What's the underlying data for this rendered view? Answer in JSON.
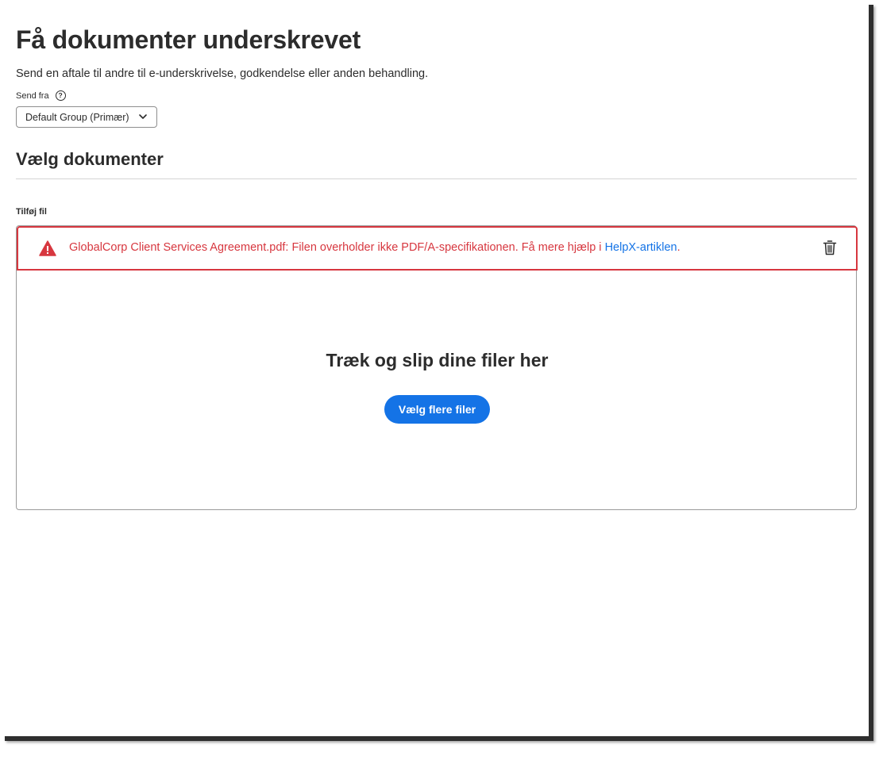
{
  "page": {
    "title": "Få dokumenter underskrevet",
    "subtitle": "Send en aftale til andre til e-underskrivelse, godkendelse eller anden behandling."
  },
  "send_from": {
    "label": "Send fra",
    "help_icon": "help-icon",
    "help_glyph": "?",
    "selected": "Default Group (Primær)"
  },
  "documents": {
    "section_title": "Vælg dokumenter",
    "add_file_label": "Tilføj fil",
    "error": {
      "icon": "alert-icon",
      "message": "GlobalCorp Client Services Agreement.pdf: Filen overholder ikke PDF/A-specifikationen. Få mere hjælp i ",
      "link_text": "HelpX-artiklen",
      "suffix": ".",
      "delete_icon": "trash-icon"
    },
    "dropzone": {
      "heading": "Træk og slip dine filer her",
      "button_label": "Vælg flere filer"
    }
  },
  "colors": {
    "accent": "#1473e6",
    "error": "#d7373f",
    "text": "#2c2c2c",
    "border": "#9a9a9a"
  }
}
